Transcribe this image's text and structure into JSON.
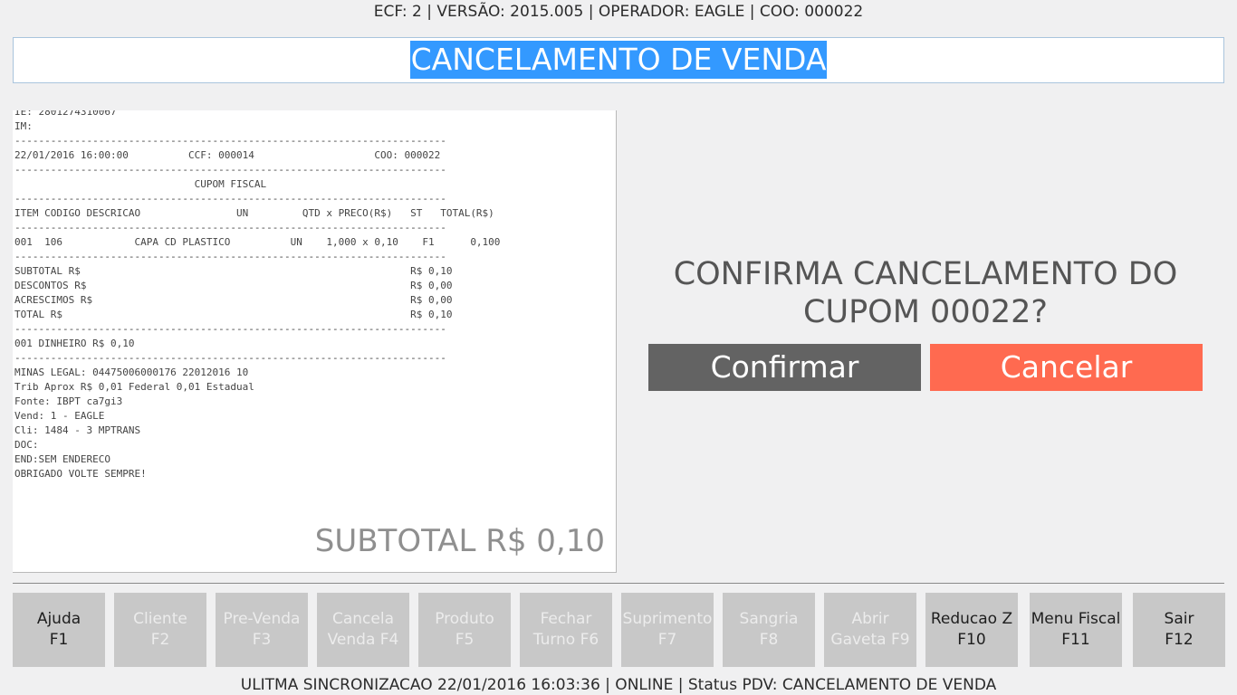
{
  "header": {
    "status_line": "ECF: 2 | VERSÃO: 2015.005 | OPERADOR: EAGLE | COO: 000022",
    "title": "CANCELAMENTO DE VENDA",
    "title_highlight_color": "#3399ff"
  },
  "receipt": {
    "text": "IE: 2801274310067\nIM:\n------------------------------------------------------------------------\n22/01/2016 16:00:00          CCF: 000014                    COO: 000022\n------------------------------------------------------------------------\n                              CUPOM FISCAL\n------------------------------------------------------------------------\nITEM CODIGO DESCRICAO                UN         QTD x PRECO(R$)   ST   TOTAL(R$)\n------------------------------------------------------------------------\n001  106            CAPA CD PLASTICO          UN    1,000 x 0,10    F1      0,100\n------------------------------------------------------------------------\nSUBTOTAL R$                                                       R$ 0,10\nDESCONTOS R$                                                      R$ 0,00\nACRESCIMOS R$                                                     R$ 0,00\nTOTAL R$                                                          R$ 0,10\n------------------------------------------------------------------------\n001 DINHEIRO R$ 0,10\n------------------------------------------------------------------------\nMINAS LEGAL: 04475006000176 22012016 10\nTrib Aprox R$ 0,01 Federal 0,01 Estadual\nFonte: IBPT ca7gi3\nVend: 1 - EAGLE\nCli: 1484 - 3 MPTRANS\nDOC:\nEND:SEM ENDERECO\nOBRIGADO VOLTE SEMPRE!",
    "subtotal_label": "SUBTOTAL R$ 0,10"
  },
  "dialog": {
    "message_line1": "CONFIRMA CANCELAMENTO DO",
    "message_line2": "CUPOM 00022?",
    "confirm_label": "Confirmar",
    "cancel_label": "Cancelar",
    "confirm_color": "#636363",
    "cancel_color": "#ff6a50"
  },
  "function_keys": [
    {
      "line1": "Ajuda",
      "line2": "F1",
      "enabled": true
    },
    {
      "line1": "Cliente",
      "line2": "F2",
      "enabled": false
    },
    {
      "line1": "Pre-Venda",
      "line2": "F3",
      "enabled": false
    },
    {
      "line1": "Cancela",
      "line2": "Venda F4",
      "enabled": false
    },
    {
      "line1": "Produto",
      "line2": "F5",
      "enabled": false
    },
    {
      "line1": "Fechar",
      "line2": "Turno F6",
      "enabled": false
    },
    {
      "line1": "Suprimento",
      "line2": "F7",
      "enabled": false
    },
    {
      "line1": "Sangria",
      "line2": "F8",
      "enabled": false
    },
    {
      "line1": "Abrir",
      "line2": "Gaveta F9",
      "enabled": false
    },
    {
      "line1": "Reducao Z",
      "line2": "F10",
      "enabled": true
    },
    {
      "line1": "Menu Fiscal",
      "line2": "F11",
      "enabled": true
    },
    {
      "line1": "Sair",
      "line2": "F12",
      "enabled": true
    }
  ],
  "footer": {
    "status_line": "ULITMA SINCRONIZACAO 22/01/2016 16:03:36 | ONLINE | Status PDV: CANCELAMENTO DE VENDA"
  }
}
